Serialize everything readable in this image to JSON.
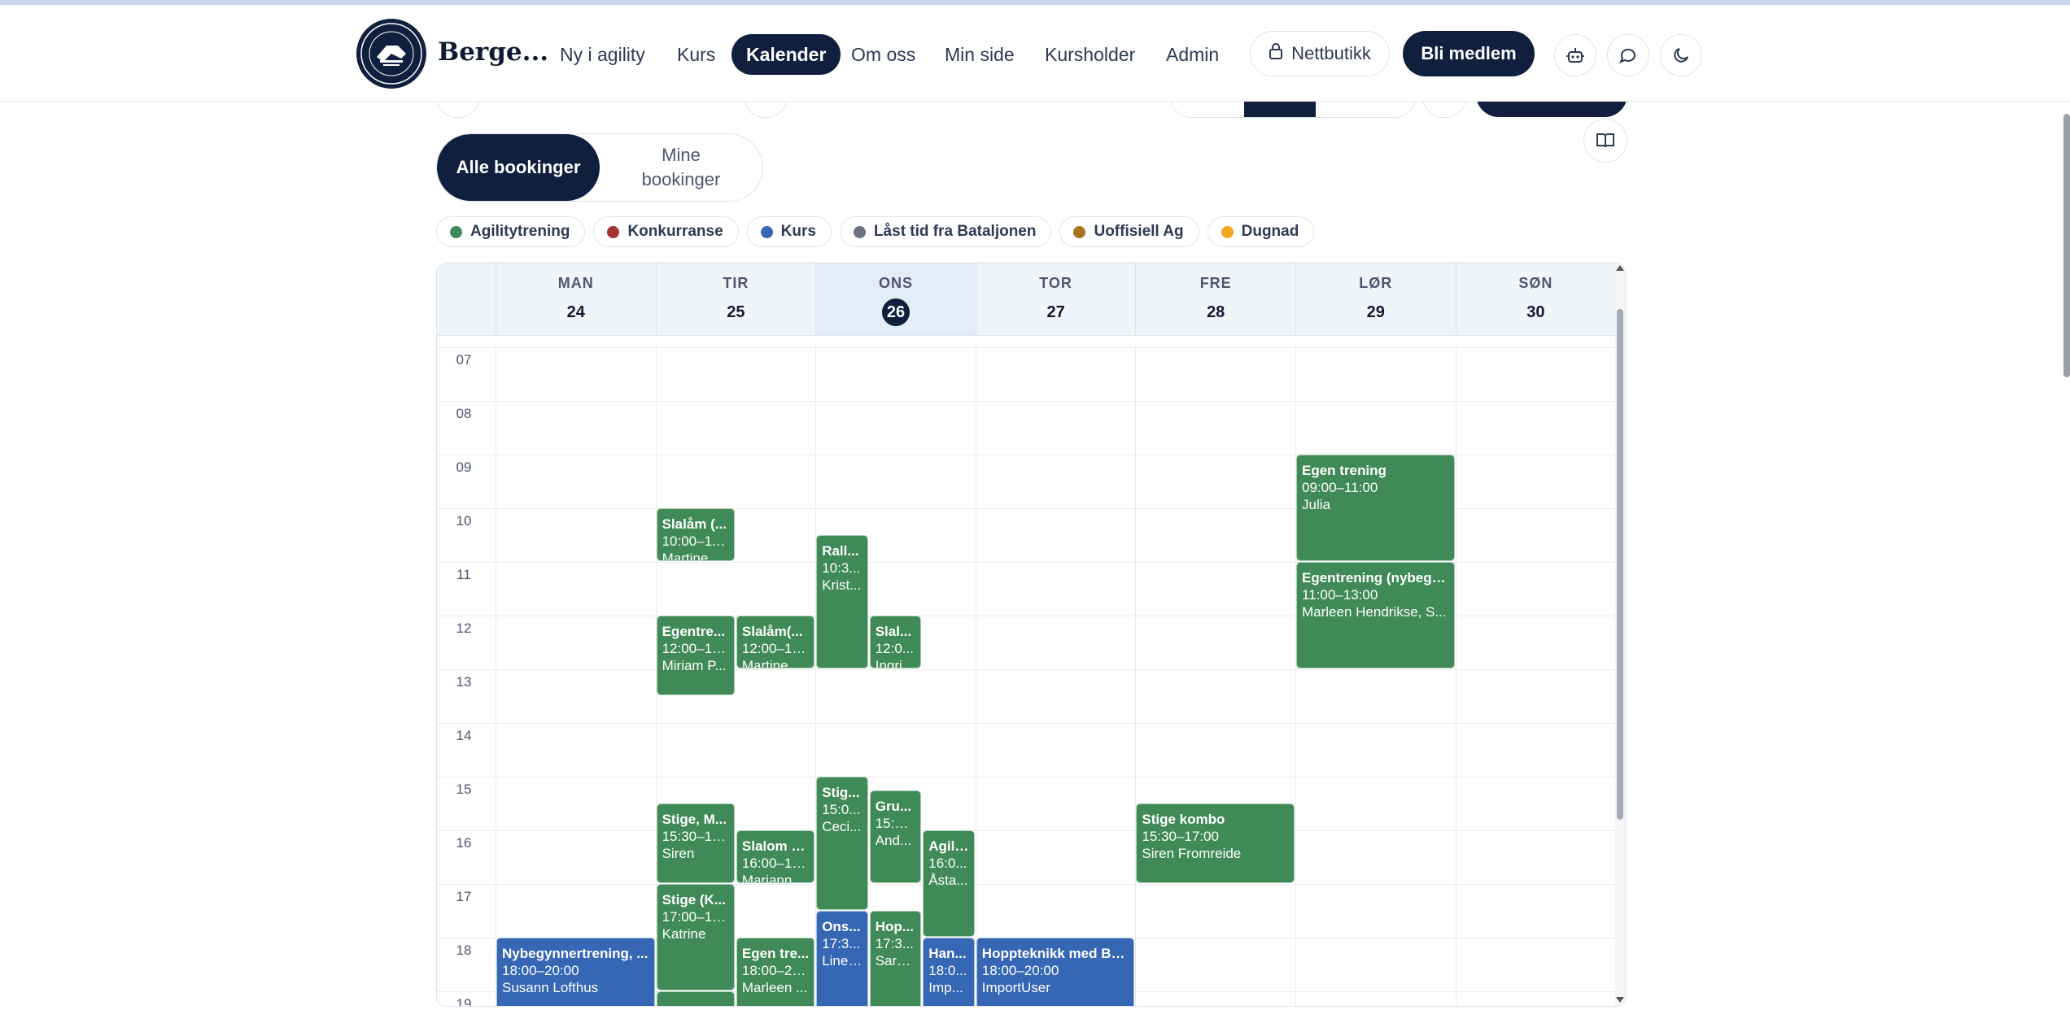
{
  "brand": {
    "name": "Berge..."
  },
  "nav": {
    "items": [
      {
        "label": "Ny i agility",
        "active": false
      },
      {
        "label": "Kurs",
        "active": false
      },
      {
        "label": "Kalender",
        "active": true
      },
      {
        "label": "Om oss",
        "active": false
      },
      {
        "label": "Min side",
        "active": false
      },
      {
        "label": "Kursholder",
        "active": false
      },
      {
        "label": "Admin",
        "active": false
      }
    ],
    "shop_label": "Nettbutikk",
    "join_label": "Bli medlem",
    "icons": [
      "robot-icon",
      "chat-icon",
      "moon-icon"
    ]
  },
  "filter": {
    "all_label": "Alle bookinger",
    "mine_label": "Mine bookinger"
  },
  "legend": [
    {
      "label": "Agilitytrening",
      "color": "#3f8a56"
    },
    {
      "label": "Konkurranse",
      "color": "#a33232"
    },
    {
      "label": "Kurs",
      "color": "#3567b5"
    },
    {
      "label": "Låst tid fra Bataljonen",
      "color": "#6b7280"
    },
    {
      "label": "Uoffisiell Ag",
      "color": "#a8731e"
    },
    {
      "label": "Dugnad",
      "color": "#f2a51f"
    }
  ],
  "calendar": {
    "days": [
      {
        "name": "MAN",
        "num": "24",
        "today": false
      },
      {
        "name": "TIR",
        "num": "25",
        "today": false
      },
      {
        "name": "ONS",
        "num": "26",
        "today": true
      },
      {
        "name": "TOR",
        "num": "27",
        "today": false
      },
      {
        "name": "FRE",
        "num": "28",
        "today": false
      },
      {
        "name": "LØR",
        "num": "29",
        "today": false
      },
      {
        "name": "SØN",
        "num": "30",
        "today": false
      }
    ],
    "hours": [
      "07",
      "08",
      "09",
      "10",
      "11",
      "12",
      "13",
      "14",
      "15",
      "16",
      "17",
      "18",
      "19"
    ],
    "events": [
      {
        "day": 1,
        "lane": 0,
        "lanes": 2,
        "start": 10,
        "end": 11,
        "title": "Slalåm (...",
        "time": "10:00–11:...",
        "person": "Martine",
        "color": "#3f8a56"
      },
      {
        "day": 1,
        "lane": 0,
        "lanes": 2,
        "start": 12,
        "end": 13.5,
        "title": "Egentre...",
        "time": "12:00–13...",
        "person": "Miriam P...",
        "color": "#3f8a56"
      },
      {
        "day": 1,
        "lane": 1,
        "lanes": 2,
        "start": 12,
        "end": 13,
        "title": "Slalåm(...",
        "time": "12:00–13...",
        "person": "Martine ...",
        "color": "#3f8a56"
      },
      {
        "day": 1,
        "lane": 0,
        "lanes": 2,
        "start": 15.5,
        "end": 17,
        "title": "Stige, M...",
        "time": "15:30–17:...",
        "person": "Siren",
        "color": "#3f8a56"
      },
      {
        "day": 1,
        "lane": 1,
        "lanes": 2,
        "start": 16,
        "end": 17,
        "title": "Slalom alé",
        "time": "16:00–17:...",
        "person": "Mariann...",
        "color": "#3f8a56"
      },
      {
        "day": 1,
        "lane": 0,
        "lanes": 2,
        "start": 17,
        "end": 19,
        "title": "Stige (K...",
        "time": "17:00–19:...",
        "person": "Katrine",
        "color": "#3f8a56"
      },
      {
        "day": 1,
        "lane": 1,
        "lanes": 2,
        "start": 18,
        "end": 20,
        "title": "Egen tre...",
        "time": "18:00–20...",
        "person": "Marleen ...",
        "color": "#3f8a56"
      },
      {
        "day": 1,
        "lane": 0,
        "lanes": 2,
        "start": 19,
        "end": 20,
        "title": "",
        "time": "",
        "person": "",
        "color": "#3f8a56"
      },
      {
        "day": 2,
        "lane": 0,
        "lanes": 3,
        "start": 10.5,
        "end": 13,
        "title": "Rall...",
        "time": "10:3...",
        "person": "Krist...",
        "color": "#3f8a56"
      },
      {
        "day": 2,
        "lane": 1,
        "lanes": 3,
        "start": 12,
        "end": 13,
        "title": "Slal...",
        "time": "12:0...",
        "person": "Ingri...",
        "color": "#3f8a56"
      },
      {
        "day": 2,
        "lane": 0,
        "lanes": 3,
        "start": 15,
        "end": 17.5,
        "title": "Stig...",
        "time": "15:0...",
        "person": "Ceci...",
        "color": "#3f8a56"
      },
      {
        "day": 2,
        "lane": 1,
        "lanes": 3,
        "start": 15.25,
        "end": 17,
        "title": "Gru...",
        "time": "15:15...",
        "person": "And...",
        "color": "#3f8a56"
      },
      {
        "day": 2,
        "lane": 2,
        "lanes": 3,
        "start": 16,
        "end": 18,
        "title": "Agili...",
        "time": "16:0...",
        "person": "Åsta...",
        "color": "#3f8a56"
      },
      {
        "day": 2,
        "lane": 0,
        "lanes": 3,
        "start": 17.5,
        "end": 20,
        "title": "Ons...",
        "time": "17:3...",
        "person": "Line ...",
        "color": "#3567b5"
      },
      {
        "day": 2,
        "lane": 1,
        "lanes": 3,
        "start": 17.5,
        "end": 20,
        "title": "Hop...",
        "time": "17:3...",
        "person": "Sara...",
        "color": "#3f8a56"
      },
      {
        "day": 2,
        "lane": 2,
        "lanes": 3,
        "start": 18,
        "end": 20,
        "title": "Han...",
        "time": "18:0...",
        "person": "Imp...",
        "color": "#3567b5"
      },
      {
        "day": 0,
        "lane": 0,
        "lanes": 1,
        "start": 18,
        "end": 20,
        "title": "Nybegynnertrening, ...",
        "time": "18:00–20:00",
        "person": "Susann Lofthus",
        "color": "#3567b5"
      },
      {
        "day": 3,
        "lane": 0,
        "lanes": 1,
        "start": 18,
        "end": 20,
        "title": "Hoppteknikk med Bo...",
        "time": "18:00–20:00",
        "person": "ImportUser",
        "color": "#3567b5"
      },
      {
        "day": 4,
        "lane": 0,
        "lanes": 1,
        "start": 15.5,
        "end": 17,
        "title": "Stige kombo",
        "time": "15:30–17:00",
        "person": "Siren Fromreide",
        "color": "#3f8a56"
      },
      {
        "day": 5,
        "lane": 0,
        "lanes": 1,
        "start": 9,
        "end": 11,
        "title": "Egen trening",
        "time": "09:00–11:00",
        "person": "Julia",
        "color": "#3f8a56"
      },
      {
        "day": 5,
        "lane": 0,
        "lanes": 1,
        "start": 11,
        "end": 13,
        "title": "Egentrening (nybegy...",
        "time": "11:00–13:00",
        "person": "Marleen Hendrikse, S...",
        "color": "#3f8a56"
      }
    ]
  }
}
